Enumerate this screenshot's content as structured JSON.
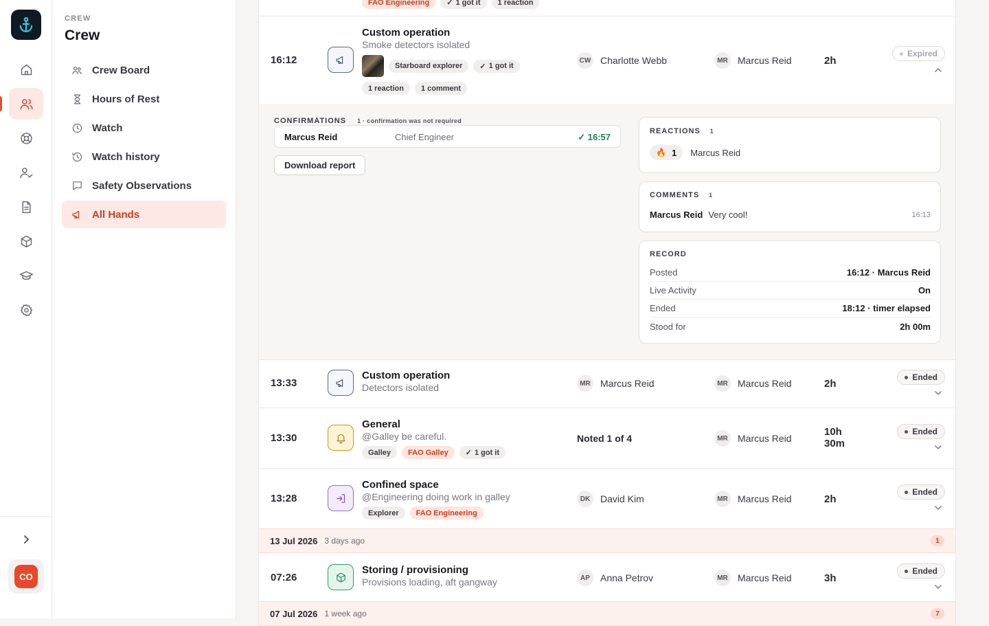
{
  "app": {
    "avatar_initials": "CO"
  },
  "sidebar": {
    "eyebrow": "CREW",
    "title": "Crew",
    "items": [
      {
        "label": "Crew Board",
        "icon": "users-small-icon"
      },
      {
        "label": "Hours of Rest",
        "icon": "hourglass-icon"
      },
      {
        "label": "Watch",
        "icon": "clock-icon"
      },
      {
        "label": "Watch history",
        "icon": "history-icon"
      },
      {
        "label": "Safety Observations",
        "icon": "message-square-icon"
      },
      {
        "label": "All Hands",
        "icon": "megaphone-icon",
        "active": true
      }
    ]
  },
  "top_partial": {
    "chips": [
      "FAO Engineering",
      "1 got it",
      "1 reaction"
    ]
  },
  "expanded_row": {
    "time": "16:12",
    "title": "Custom operation",
    "subtitle": "Smoke detectors isolated",
    "chips": [
      "Starboard explorer",
      "1 got it"
    ],
    "chips2": [
      "1 reaction",
      "1 comment"
    ],
    "creator_initials": "CW",
    "creator": "Charlotte Webb",
    "approver_initials": "MR",
    "approver": "Marcus Reid",
    "duration": "2h",
    "status": "Expired"
  },
  "detail": {
    "confirmations_label": "CONFIRMATIONS",
    "confirmations_note": "1 · confirmation was not required",
    "confirmation": {
      "name": "Marcus Reid",
      "role": "Chief Engineer",
      "time": "16:57"
    },
    "download_label": "Download report",
    "reactions_label": "REACTIONS",
    "reactions_count": "1",
    "reaction": {
      "emoji": "🔥",
      "count": "1",
      "name": "Marcus Reid"
    },
    "comments_label": "COMMENTS",
    "comments_count": "1",
    "comment": {
      "name": "Marcus Reid",
      "text": "Very cool!",
      "time": "16:13"
    },
    "record_label": "RECORD",
    "record": [
      {
        "k": "Posted",
        "v": "16:12 · Marcus Reid"
      },
      {
        "k": "Live Activity",
        "v": "On"
      },
      {
        "k": "Ended",
        "v": "18:12 · timer elapsed"
      },
      {
        "k": "Stood for",
        "v": "2h 00m"
      }
    ]
  },
  "rows": [
    {
      "time": "13:33",
      "title": "Custom operation",
      "subtitle": "Detectors isolated",
      "creator_initials": "MR",
      "creator": "Marcus Reid",
      "approver_initials": "MR",
      "approver": "Marcus Reid",
      "duration": "2h",
      "status": "Ended"
    },
    {
      "time": "13:30",
      "title": "General",
      "subtitle": "@Galley be careful.",
      "chips": [
        "Galley",
        "FAO Galley",
        "1 got it"
      ],
      "noted": "Noted 1 of 4",
      "approver_initials": "MR",
      "approver": "Marcus Reid",
      "duration_1": "10h",
      "duration_2": "30m",
      "status": "Ended"
    },
    {
      "time": "13:28",
      "title": "Confined space",
      "subtitle": "@Engineering doing work in galley",
      "chips": [
        "Explorer",
        "FAO Engineering"
      ],
      "creator_initials": "DK",
      "creator": "David Kim",
      "approver_initials": "MR",
      "approver": "Marcus Reid",
      "duration": "2h",
      "status": "Ended"
    },
    {
      "time": "07:26",
      "title": "Storing / provisioning",
      "subtitle": "Provisions loading, aft gangway",
      "creator_initials": "AP",
      "creator": "Anna Petrov",
      "approver_initials": "MR",
      "approver": "Marcus Reid",
      "duration": "3h",
      "status": "Ended"
    }
  ],
  "date_bands": [
    {
      "date": "13 Jul 2026",
      "ago": "3 days ago",
      "count": "1"
    },
    {
      "date": "07 Jul 2026",
      "ago": "1 week ago",
      "count": "7"
    }
  ],
  "colors": {
    "accent": "#e4502c",
    "active_bg": "#fde8e3",
    "logo_bg": "#0f1a23",
    "logo_fg": "#3fc7d6"
  }
}
